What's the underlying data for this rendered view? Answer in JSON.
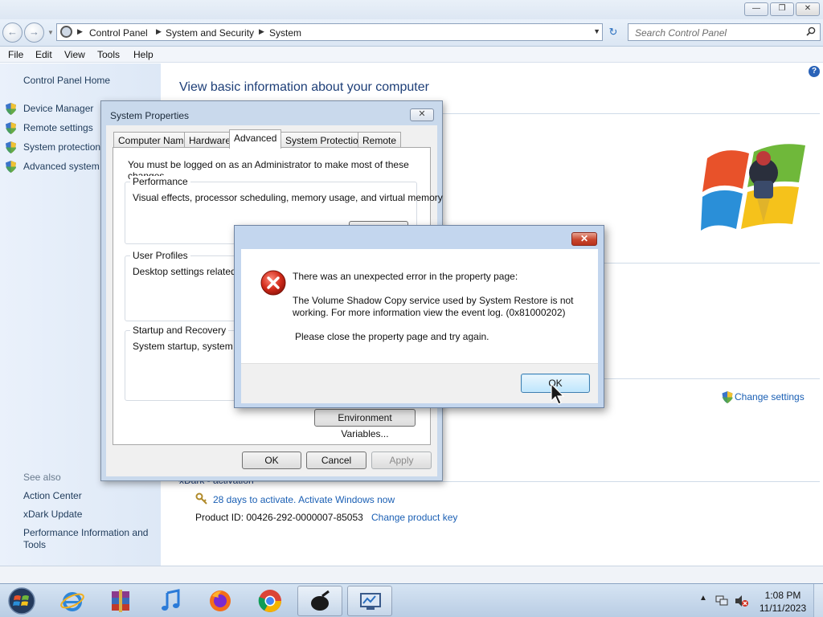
{
  "explorer": {
    "address": {
      "crumbs": [
        "Control Panel",
        "System and Security",
        "System"
      ],
      "search_placeholder": "Search Control Panel"
    },
    "menu": [
      "File",
      "Edit",
      "View",
      "Tools",
      "Help"
    ],
    "left_pane": {
      "home": "Control Panel Home",
      "tasks": [
        "Device Manager",
        "Remote settings",
        "System protection",
        "Advanced system"
      ],
      "see_also_heading": "See also",
      "see_also": [
        "Action Center",
        "xDark Update",
        "Performance Information and",
        "Tools"
      ]
    },
    "content": {
      "title": "View basic information about your computer",
      "change_settings": "Change settings",
      "activation_heading": "xDark - activation",
      "activation_link": "28 days to activate. Activate Windows now",
      "product_id": "Product ID:  00426-292-0000007-85053",
      "change_product_key": "Change product key"
    }
  },
  "system_properties": {
    "title": "System Properties",
    "tabs": [
      "Computer Name",
      "Hardware",
      "Advanced",
      "System Protection",
      "Remote"
    ],
    "active_tab": "Advanced",
    "admin_note": "You must be logged on as an Administrator to make most of these changes.",
    "performance": {
      "label": "Performance",
      "text": "Visual effects, processor scheduling, memory usage, and virtual memory"
    },
    "user_profiles": {
      "label": "User Profiles",
      "text": "Desktop settings related to"
    },
    "startup_recovery": {
      "label": "Startup and Recovery",
      "text": "System startup, system failu"
    },
    "env_button": "Environment Variables...",
    "ok": "OK",
    "cancel": "Cancel",
    "apply": "Apply"
  },
  "error_dialog": {
    "line1": "There was an unexpected error in the property page:",
    "line2": "The Volume Shadow Copy service used by System Restore is not",
    "line3": "working. For more information view the event log. (0x81000202)",
    "line4": "Please close the property page and try again.",
    "ok": "OK"
  },
  "taskbar": {
    "apps": [
      "internet-explorer",
      "winrar",
      "itunes",
      "firefox",
      "chrome",
      "app-dark",
      "system-monitor"
    ],
    "time": "1:08 PM",
    "date": "11/11/2023"
  },
  "colors": {
    "link": "#1a5fb4",
    "title_blue": "#1e3f78",
    "error_red": "#d12a1a",
    "close_red": "#c9472e"
  }
}
